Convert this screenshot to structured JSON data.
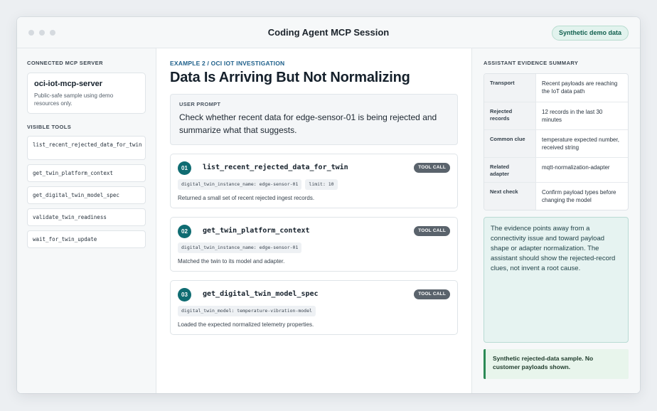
{
  "window": {
    "title": "Coding Agent MCP Session",
    "badge": "Synthetic demo data"
  },
  "sidebar": {
    "server_section_label": "CONNECTED MCP SERVER",
    "server_name": "oci-iot-mcp-server",
    "server_desc": "Public-safe sample using demo resources only.",
    "tools_section_label": "VISIBLE TOOLS",
    "tools": [
      "list_recent_rejected_data_for_twin",
      "get_twin_platform_context",
      "get_digital_twin_model_spec",
      "validate_twin_readiness",
      "wait_for_twin_update"
    ]
  },
  "main": {
    "eyebrow": "EXAMPLE 2 / OCI IOT INVESTIGATION",
    "heading": "Data Is Arriving But Not Normalizing",
    "prompt_label": "USER PROMPT",
    "prompt_text": "Check whether recent data for edge-sensor-01 is being rejected and summarize what that suggests.",
    "tool_calls": [
      {
        "num": "01",
        "name": "list_recent_rejected_data_for_twin",
        "badge": "TOOL CALL",
        "params": [
          "digital_twin_instance_name: edge-sensor-01",
          "limit: 10"
        ],
        "result": "Returned a small set of recent rejected ingest records."
      },
      {
        "num": "02",
        "name": "get_twin_platform_context",
        "badge": "TOOL CALL",
        "params": [
          "digital_twin_instance_name: edge-sensor-01"
        ],
        "result": "Matched the twin to its model and adapter."
      },
      {
        "num": "03",
        "name": "get_digital_twin_model_spec",
        "badge": "TOOL CALL",
        "params": [
          "digital_twin_model: temperature-vibration-model"
        ],
        "result": "Loaded the expected normalized telemetry properties."
      }
    ]
  },
  "evidence": {
    "label": "ASSISTANT EVIDENCE SUMMARY",
    "rows": [
      {
        "key": "Transport",
        "value": "Recent payloads are reaching the IoT data path"
      },
      {
        "key": "Rejected records",
        "value": "12 records in the last 30 minutes"
      },
      {
        "key": "Common clue",
        "value": "temperature expected number, received string"
      },
      {
        "key": "Related adapter",
        "value": "mqtt-normalization-adapter"
      },
      {
        "key": "Next check",
        "value": "Confirm payload types before changing the model"
      }
    ],
    "conclusion": "The evidence points away from a connectivity issue and toward payload shape or adapter normalization. The assistant should show the rejected-record clues, not invent a root cause.",
    "note": "Synthetic rejected-data sample. No customer payloads shown."
  },
  "colors": {
    "accent_teal": "#0f6c72",
    "eyebrow_blue": "#1d5f8a",
    "note_green": "#2b8a55"
  }
}
